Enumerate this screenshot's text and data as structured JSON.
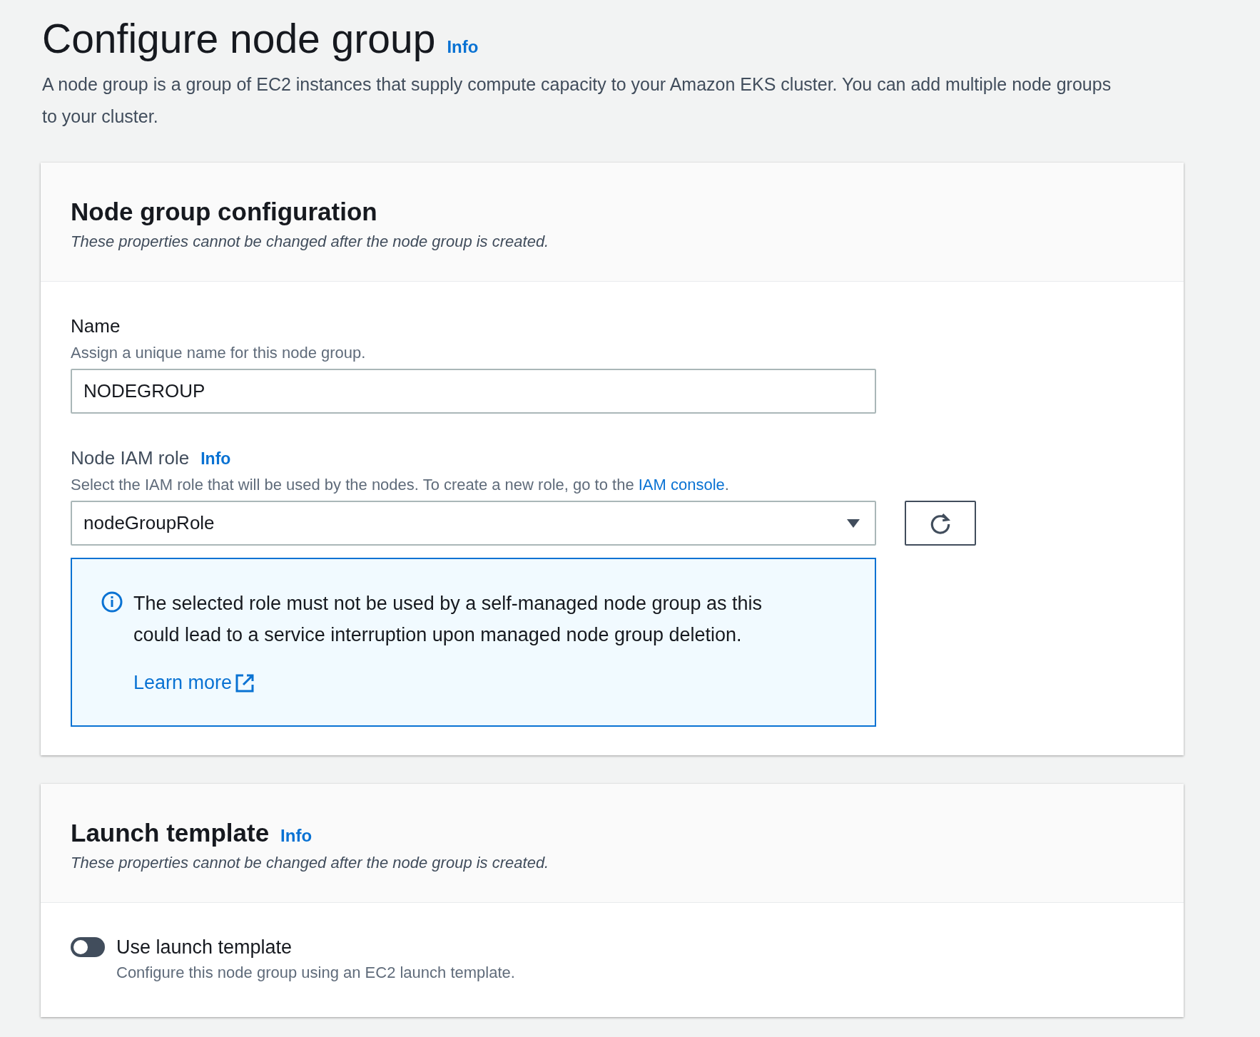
{
  "page": {
    "title": "Configure node group",
    "info": "Info",
    "description": "A node group is a group of EC2 instances that supply compute capacity to your Amazon EKS cluster. You can add multiple node groups to your cluster."
  },
  "sections": [
    {
      "title": "Node group configuration",
      "subtitle": "These properties cannot be changed after the node group is created.",
      "fields": [
        {
          "kind": "text",
          "label": "Name",
          "hint": "Assign a unique name for this node group.",
          "value": "NODEGROUP"
        },
        {
          "kind": "select",
          "label": "Node IAM role",
          "info": "Info",
          "hint": "Select the IAM role that will be used by the nodes. To create a new role, go to the",
          "hint_link": "IAM console",
          "hint_end": ".",
          "value": "nodeGroupRole",
          "refresh": true,
          "alert": {
            "text": "The selected role must not be used by a self-managed node group as this could lead to a service interruption upon managed node group deletion.",
            "link": "Learn more"
          }
        }
      ]
    },
    {
      "title": "Launch template",
      "info": "Info",
      "subtitle": "These properties cannot be changed after the node group is created.",
      "fields": [
        {
          "kind": "toggle",
          "label": "Use launch template",
          "hint": "Configure this node group using an EC2 launch template.",
          "on": false
        }
      ]
    }
  ]
}
